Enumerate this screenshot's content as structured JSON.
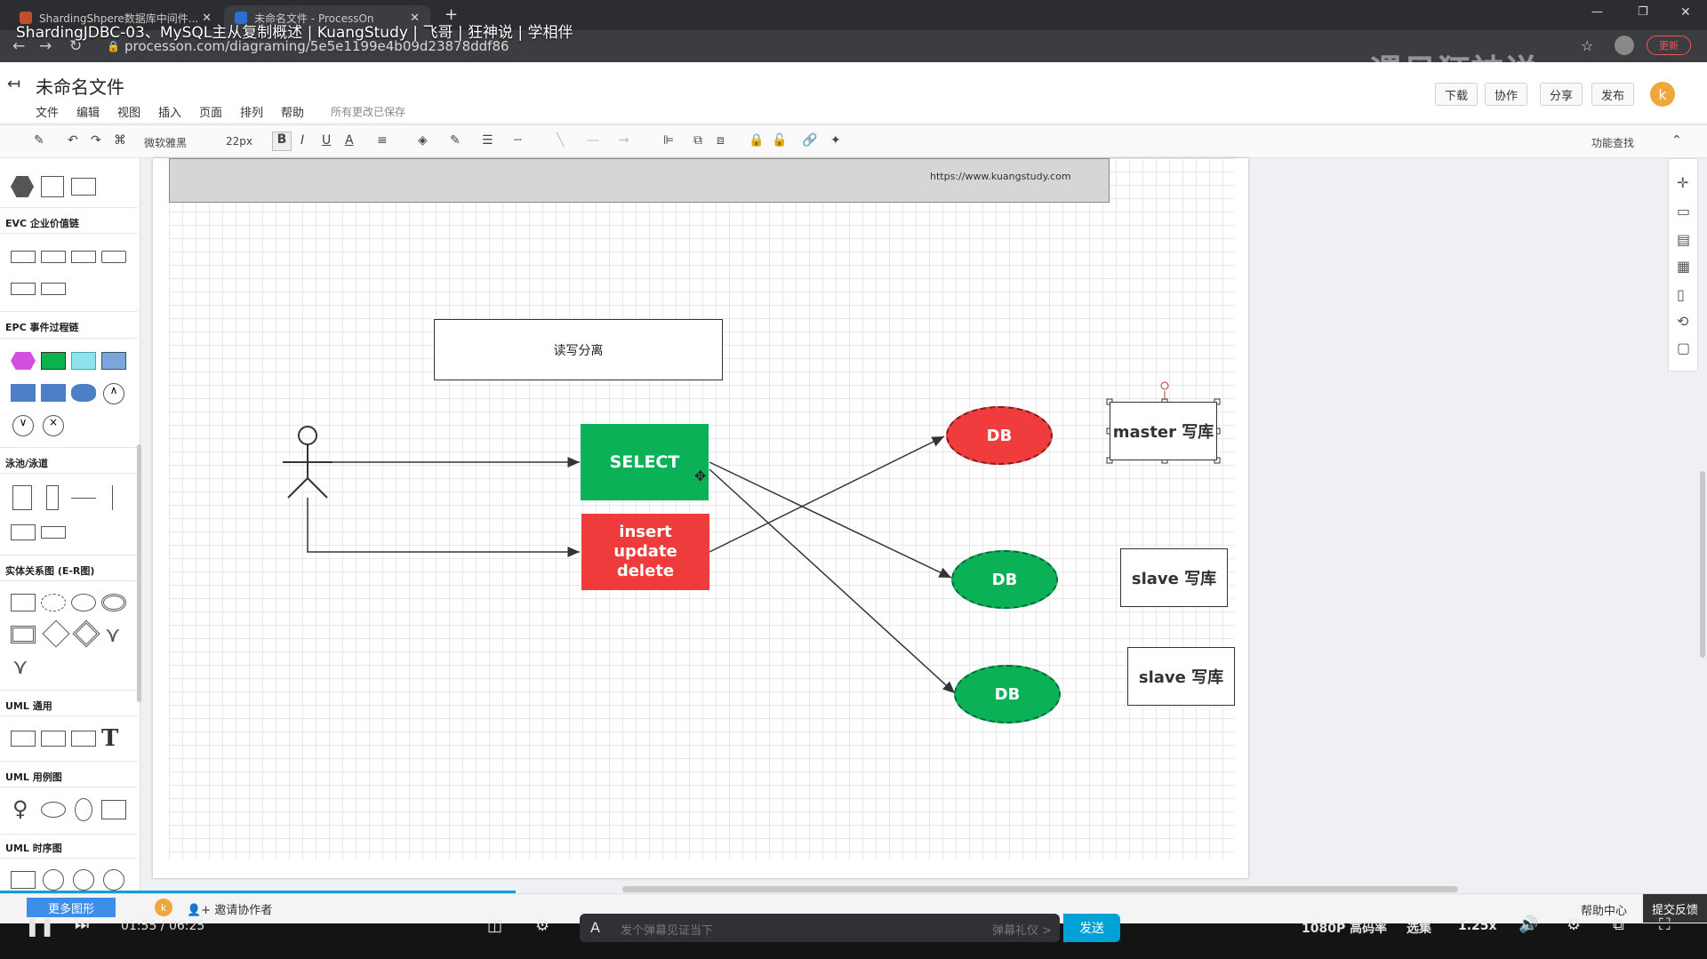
{
  "browser": {
    "tabs": [
      {
        "label": "ShardingShpere数据库中间件..."
      },
      {
        "label": "未命名文件 - ProcessOn"
      }
    ],
    "video_title": "ShardingJDBC-03、MySQL主从复制概述 | KuangStudy | 飞哥 | 狂神说 | 学相伴",
    "url": "processon.com/diagraming/5e5e1199e4b09d23878ddf86",
    "update_label": "更新",
    "watermark": "遇见狂神说"
  },
  "header": {
    "file_title": "未命名文件",
    "menus": [
      "文件",
      "编辑",
      "视图",
      "插入",
      "页面",
      "排列",
      "帮助"
    ],
    "saved_status": "所有更改已保存",
    "buttons": [
      "下载",
      "协作",
      "分享",
      "发布"
    ],
    "avatar_letter": "k"
  },
  "toolbar": {
    "font": "微软雅黑",
    "font_size": "22px",
    "bold": "B",
    "italic": "I",
    "underline": "U",
    "font_color": "A",
    "search": "功能查找"
  },
  "left_panel": {
    "categories": [
      "EVC 企业价值链",
      "EPC 事件过程链",
      "泳池/泳道",
      "实体关系图 (E-R图)",
      "UML 通用",
      "UML 用例图",
      "UML 时序图"
    ]
  },
  "canvas": {
    "banner_url": "https://www.kuangstudy.com",
    "title_box": "读写分离",
    "select_box": "SELECT",
    "write_box": [
      "insert",
      "update",
      "delete"
    ],
    "db_labels": [
      "DB",
      "DB",
      "DB"
    ],
    "labels": [
      "master 写库",
      "slave 写库",
      "slave 写库"
    ],
    "colors": {
      "select": "#0bb157",
      "write": "#ef3b3b",
      "master_db": "#f03c3c",
      "slave_db": "#0bb157"
    }
  },
  "statusbar": {
    "more_shapes": "更多图形",
    "invite": "邀请协作者",
    "help": "帮助中心",
    "feedback": "提交反馈"
  },
  "player": {
    "time": "01:55 / 06:25",
    "danmaku_placeholder": "发个弹幕见证当下",
    "etiquette": "弹幕礼仪 >",
    "send": "发送",
    "quality": "1080P 高码率",
    "episodes": "选集",
    "speed": "1.25x"
  }
}
